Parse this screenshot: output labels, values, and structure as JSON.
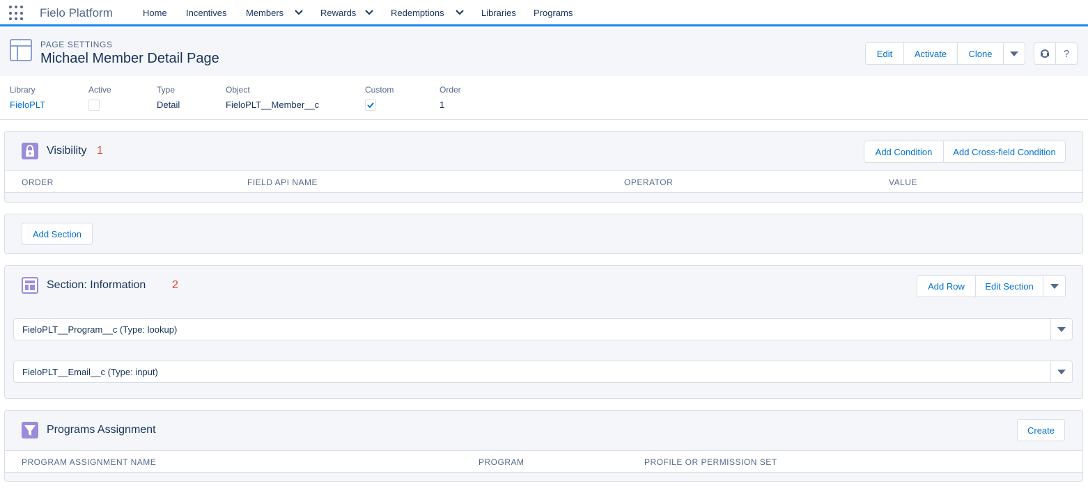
{
  "app": {
    "name": "Fielo Platform",
    "nav": [
      {
        "label": "Home",
        "has_menu": false
      },
      {
        "label": "Incentives",
        "has_menu": false
      },
      {
        "label": "Members",
        "has_menu": true
      },
      {
        "label": "Rewards",
        "has_menu": true
      },
      {
        "label": "Redemptions",
        "has_menu": true
      },
      {
        "label": "Libraries",
        "has_menu": false
      },
      {
        "label": "Programs",
        "has_menu": false
      }
    ]
  },
  "header": {
    "eyebrow": "Page Settings",
    "title": "Michael Member Detail Page",
    "actions": [
      "Edit",
      "Activate",
      "Clone"
    ],
    "help_label": "?"
  },
  "details": {
    "library": {
      "label": "Library",
      "value": "FieloPLT"
    },
    "active": {
      "label": "Active",
      "checked": false
    },
    "type": {
      "label": "Type",
      "value": "Detail"
    },
    "object": {
      "label": "Object",
      "value": "FieloPLT__Member__c"
    },
    "custom": {
      "label": "Custom",
      "checked": true
    },
    "order": {
      "label": "Order",
      "value": "1"
    }
  },
  "visibility": {
    "title": "Visibility",
    "count": "1",
    "add_condition": "Add Condition",
    "add_cross_field": "Add Cross-field Condition",
    "columns": [
      "Order",
      "Field API Name",
      "Operator",
      "Value"
    ]
  },
  "add_section": {
    "label": "Add Section"
  },
  "section": {
    "title": "Section: Information",
    "count": "2",
    "add_row": "Add Row",
    "edit_section": "Edit Section",
    "fields": [
      "FieloPLT__Program__c (Type: lookup)",
      "FieloPLT__Email__c (Type: input)"
    ]
  },
  "programs_assignment": {
    "title": "Programs Assignment",
    "create": "Create",
    "columns": [
      "Program Assignment Name",
      "Program",
      "Profile or Permission Set"
    ]
  },
  "colors": {
    "brand": "#1589ee",
    "link": "#0070d2",
    "text": "#16325c",
    "muted": "#54698d",
    "icon_purple": "#9b8bda",
    "badge_red": "#e5443b"
  }
}
